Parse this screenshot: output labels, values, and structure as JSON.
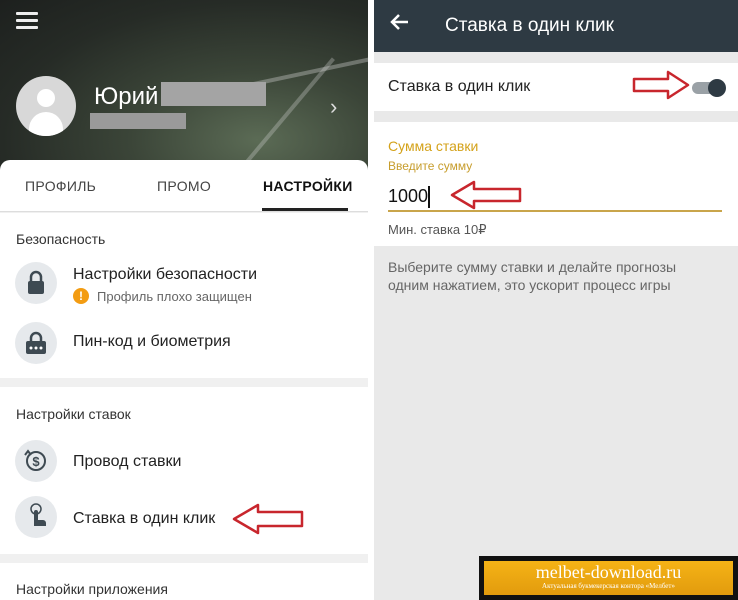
{
  "left": {
    "profile": {
      "name": "Юрий"
    },
    "tabs": [
      {
        "label": "ПРОФИЛЬ",
        "active": false
      },
      {
        "label": "ПРОМО",
        "active": false
      },
      {
        "label": "НАСТРОЙКИ",
        "active": true
      }
    ],
    "security": {
      "title": "Безопасность",
      "items": [
        {
          "label": "Настройки безопасности",
          "sub": "Профиль плохо защищен",
          "icon": "lock-icon"
        },
        {
          "label": "Пин-код и биометрия",
          "icon": "pin-lock-icon"
        }
      ]
    },
    "bet_settings": {
      "title": "Настройки ставок",
      "items": [
        {
          "label": "Провод ставки",
          "icon": "dollar-refresh-icon"
        },
        {
          "label": "Ставка в один клик",
          "icon": "tap-finger-icon"
        }
      ]
    },
    "app_settings": {
      "title": "Настройки приложения"
    }
  },
  "right": {
    "header": {
      "title": "Ставка в один клик"
    },
    "toggle": {
      "label": "Ставка в один клик",
      "on": true
    },
    "amount": {
      "title": "Сумма ставки",
      "hint": "Введите сумму",
      "value": "1000",
      "min_bet": "Мин. ставка 10₽"
    },
    "description": "Выберите сумму ставки и делайте прогнозы одним нажатием, это ускорит процесс игры"
  },
  "watermark": {
    "site": "melbet-download.ru",
    "tagline": "Актуальная букмекерская контора «Мелбет»"
  },
  "colors": {
    "header_bg": "#2e3a43",
    "accent_gold": "#d4a21a",
    "annotation_arrow": "#c8262d",
    "warning": "#f39c12"
  }
}
